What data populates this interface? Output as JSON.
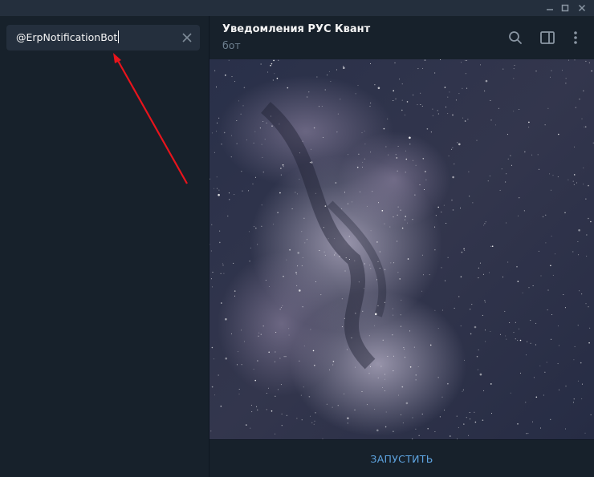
{
  "window": {
    "controls": {
      "minimize_icon": "minimize-icon",
      "maximize_icon": "maximize-icon",
      "close_icon": "close-icon"
    }
  },
  "sidebar": {
    "search": {
      "value": "@ErpNotificationBot",
      "clear_icon": "close-icon"
    }
  },
  "chat": {
    "header": {
      "title": "Уведомления РУС Квант",
      "subtitle": "бот",
      "icons": [
        "search-icon",
        "sidebar-toggle-icon",
        "more-vertical-icon"
      ]
    },
    "bottom": {
      "start_label": "ЗАПУСТИТЬ"
    }
  },
  "colors": {
    "sidebar_bg": "#17212b",
    "titlebar_bg": "#242f3d",
    "input_bg": "#242f3d",
    "accent": "#5ea4e1",
    "subtitle": "#6d7f8f",
    "annotation_arrow": "#e8141c"
  }
}
